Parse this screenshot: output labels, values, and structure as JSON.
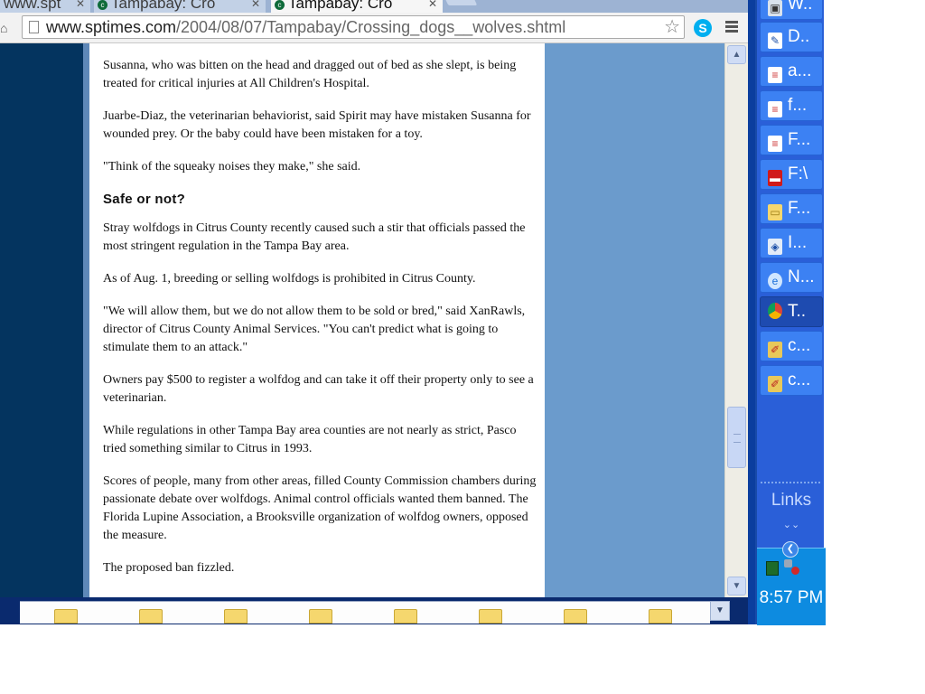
{
  "browser": {
    "tabs": [
      {
        "title": "www.spt",
        "active": false
      },
      {
        "title": "Tampabay: Cro",
        "active": false
      },
      {
        "title": "Tampabay: Cro",
        "active": true
      }
    ],
    "url_host": "www.sptimes.com",
    "url_path": "/2004/08/07/Tampabay/Crossing_dogs__wolves.shtml"
  },
  "article": {
    "paragraphs_before": [
      "Susanna, who was bitten on the head and dragged out of bed as she slept, is being treated for critical injuries at All Children's Hospital.",
      "Juarbe-Diaz, the veterinarian behaviorist, said Spirit may have mistaken Susanna for wounded prey. Or the baby could have been mistaken for a toy.",
      "\"Think of the squeaky noises they make,\" she said."
    ],
    "subheading": "Safe or not?",
    "paragraphs_after": [
      "Stray wolfdogs in Citrus County recently caused such a stir that officials passed the most stringent regulation in the Tampa Bay area.",
      "As of Aug. 1, breeding or selling wolfdogs is prohibited in Citrus County.",
      "\"We will allow them, but we do not allow them to be sold or bred,\" said XanRawls, director of Citrus County Animal Services. \"You can't predict what is going to stimulate them to an attack.\"",
      "Owners pay $500 to register a wolfdog and can take it off their property only to see a veterinarian.",
      "While regulations in other Tampa Bay area counties are not nearly as strict, Pasco tried something similar to Citrus in 1993.",
      "Scores of people, many from other areas, filled County Commission chambers during passionate debate over wolfdogs. Animal control officials wanted them banned. The Florida Lupine Association, a Brooksville organization of wolfdog owners, opposed the measure.",
      "The proposed ban fizzled."
    ]
  },
  "scroll_position_fraction": 0.72,
  "taskbar": {
    "items": [
      {
        "label": "W..",
        "icon": "app-icon",
        "active": false
      },
      {
        "label": "D..",
        "icon": "document-icon",
        "active": false
      },
      {
        "label": "a...",
        "icon": "notepad-icon",
        "active": false
      },
      {
        "label": "f...",
        "icon": "notepad-icon",
        "active": false
      },
      {
        "label": "F...",
        "icon": "notepad-icon",
        "active": false
      },
      {
        "label": "F:\\",
        "icon": "drive-icon",
        "active": false
      },
      {
        "label": "F...",
        "icon": "folder-icon",
        "active": false
      },
      {
        "label": "I...",
        "icon": "network-icon",
        "active": false
      },
      {
        "label": "N...",
        "icon": "ie-icon",
        "active": false
      },
      {
        "label": "T..",
        "icon": "chrome-icon",
        "active": true
      },
      {
        "label": "c...",
        "icon": "paint-icon",
        "active": false
      },
      {
        "label": "c...",
        "icon": "paint-icon",
        "active": false
      }
    ],
    "links_label": "Links",
    "clock": "8:57 PM"
  },
  "colors": {
    "page_background": "#6b9bcc",
    "left_rail": "#04345f",
    "taskbar": "#2a5fd8",
    "tray": "#0d8be0"
  }
}
